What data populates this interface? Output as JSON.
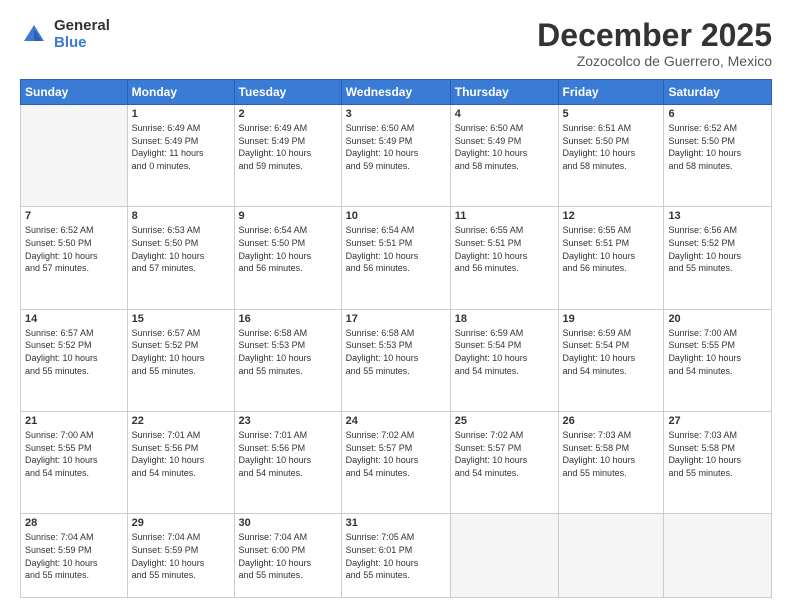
{
  "logo": {
    "general": "General",
    "blue": "Blue"
  },
  "title": "December 2025",
  "location": "Zozocolco de Guerrero, Mexico",
  "weekdays": [
    "Sunday",
    "Monday",
    "Tuesday",
    "Wednesday",
    "Thursday",
    "Friday",
    "Saturday"
  ],
  "weeks": [
    [
      {
        "day": "",
        "info": ""
      },
      {
        "day": "1",
        "info": "Sunrise: 6:49 AM\nSunset: 5:49 PM\nDaylight: 11 hours\nand 0 minutes."
      },
      {
        "day": "2",
        "info": "Sunrise: 6:49 AM\nSunset: 5:49 PM\nDaylight: 10 hours\nand 59 minutes."
      },
      {
        "day": "3",
        "info": "Sunrise: 6:50 AM\nSunset: 5:49 PM\nDaylight: 10 hours\nand 59 minutes."
      },
      {
        "day": "4",
        "info": "Sunrise: 6:50 AM\nSunset: 5:49 PM\nDaylight: 10 hours\nand 58 minutes."
      },
      {
        "day": "5",
        "info": "Sunrise: 6:51 AM\nSunset: 5:50 PM\nDaylight: 10 hours\nand 58 minutes."
      },
      {
        "day": "6",
        "info": "Sunrise: 6:52 AM\nSunset: 5:50 PM\nDaylight: 10 hours\nand 58 minutes."
      }
    ],
    [
      {
        "day": "7",
        "info": "Sunrise: 6:52 AM\nSunset: 5:50 PM\nDaylight: 10 hours\nand 57 minutes."
      },
      {
        "day": "8",
        "info": "Sunrise: 6:53 AM\nSunset: 5:50 PM\nDaylight: 10 hours\nand 57 minutes."
      },
      {
        "day": "9",
        "info": "Sunrise: 6:54 AM\nSunset: 5:50 PM\nDaylight: 10 hours\nand 56 minutes."
      },
      {
        "day": "10",
        "info": "Sunrise: 6:54 AM\nSunset: 5:51 PM\nDaylight: 10 hours\nand 56 minutes."
      },
      {
        "day": "11",
        "info": "Sunrise: 6:55 AM\nSunset: 5:51 PM\nDaylight: 10 hours\nand 56 minutes."
      },
      {
        "day": "12",
        "info": "Sunrise: 6:55 AM\nSunset: 5:51 PM\nDaylight: 10 hours\nand 56 minutes."
      },
      {
        "day": "13",
        "info": "Sunrise: 6:56 AM\nSunset: 5:52 PM\nDaylight: 10 hours\nand 55 minutes."
      }
    ],
    [
      {
        "day": "14",
        "info": "Sunrise: 6:57 AM\nSunset: 5:52 PM\nDaylight: 10 hours\nand 55 minutes."
      },
      {
        "day": "15",
        "info": "Sunrise: 6:57 AM\nSunset: 5:52 PM\nDaylight: 10 hours\nand 55 minutes."
      },
      {
        "day": "16",
        "info": "Sunrise: 6:58 AM\nSunset: 5:53 PM\nDaylight: 10 hours\nand 55 minutes."
      },
      {
        "day": "17",
        "info": "Sunrise: 6:58 AM\nSunset: 5:53 PM\nDaylight: 10 hours\nand 55 minutes."
      },
      {
        "day": "18",
        "info": "Sunrise: 6:59 AM\nSunset: 5:54 PM\nDaylight: 10 hours\nand 54 minutes."
      },
      {
        "day": "19",
        "info": "Sunrise: 6:59 AM\nSunset: 5:54 PM\nDaylight: 10 hours\nand 54 minutes."
      },
      {
        "day": "20",
        "info": "Sunrise: 7:00 AM\nSunset: 5:55 PM\nDaylight: 10 hours\nand 54 minutes."
      }
    ],
    [
      {
        "day": "21",
        "info": "Sunrise: 7:00 AM\nSunset: 5:55 PM\nDaylight: 10 hours\nand 54 minutes."
      },
      {
        "day": "22",
        "info": "Sunrise: 7:01 AM\nSunset: 5:56 PM\nDaylight: 10 hours\nand 54 minutes."
      },
      {
        "day": "23",
        "info": "Sunrise: 7:01 AM\nSunset: 5:56 PM\nDaylight: 10 hours\nand 54 minutes."
      },
      {
        "day": "24",
        "info": "Sunrise: 7:02 AM\nSunset: 5:57 PM\nDaylight: 10 hours\nand 54 minutes."
      },
      {
        "day": "25",
        "info": "Sunrise: 7:02 AM\nSunset: 5:57 PM\nDaylight: 10 hours\nand 54 minutes."
      },
      {
        "day": "26",
        "info": "Sunrise: 7:03 AM\nSunset: 5:58 PM\nDaylight: 10 hours\nand 55 minutes."
      },
      {
        "day": "27",
        "info": "Sunrise: 7:03 AM\nSunset: 5:58 PM\nDaylight: 10 hours\nand 55 minutes."
      }
    ],
    [
      {
        "day": "28",
        "info": "Sunrise: 7:04 AM\nSunset: 5:59 PM\nDaylight: 10 hours\nand 55 minutes."
      },
      {
        "day": "29",
        "info": "Sunrise: 7:04 AM\nSunset: 5:59 PM\nDaylight: 10 hours\nand 55 minutes."
      },
      {
        "day": "30",
        "info": "Sunrise: 7:04 AM\nSunset: 6:00 PM\nDaylight: 10 hours\nand 55 minutes."
      },
      {
        "day": "31",
        "info": "Sunrise: 7:05 AM\nSunset: 6:01 PM\nDaylight: 10 hours\nand 55 minutes."
      },
      {
        "day": "",
        "info": ""
      },
      {
        "day": "",
        "info": ""
      },
      {
        "day": "",
        "info": ""
      }
    ]
  ]
}
